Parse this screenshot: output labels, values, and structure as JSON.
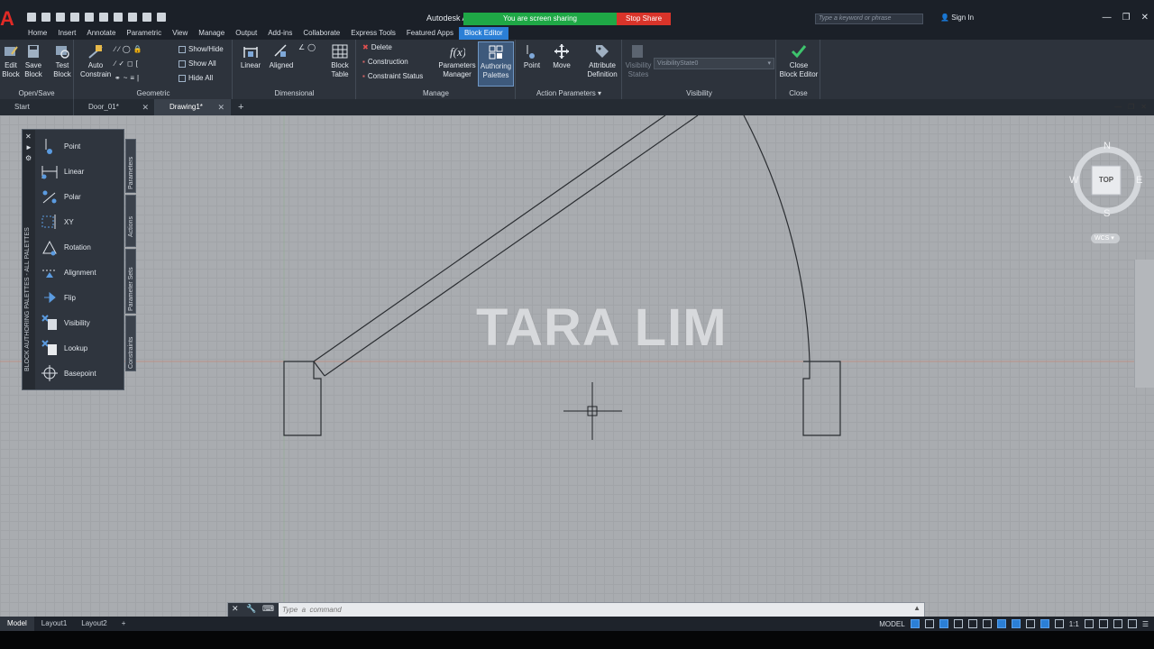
{
  "app": {
    "title": "Autodesk A",
    "logo": "A",
    "share_label": "You are screen sharing",
    "stop_share_label": "Stop Share",
    "search_placeholder": "Type a keyword or phrase",
    "signin_label": "Sign In"
  },
  "menu_tabs": [
    "Home",
    "Insert",
    "Annotate",
    "Parametric",
    "View",
    "Manage",
    "Output",
    "Add-ins",
    "Collaborate",
    "Express Tools",
    "Featured Apps",
    "Block Editor"
  ],
  "ribbon": {
    "open_save": {
      "title": "Open/Save",
      "edit_block": "Edit\nBlock",
      "save_block": "Save\nBlock",
      "test_block": "Test\nBlock"
    },
    "geometric": {
      "title": "Geometric",
      "auto_constrain": "Auto\nConstrain",
      "show_hide": "Show/Hide",
      "show_all": "Show All",
      "hide_all": "Hide All"
    },
    "dimensional": {
      "title": "Dimensional",
      "linear": "Linear",
      "aligned": "Aligned",
      "block_table": "Block\nTable"
    },
    "manage": {
      "title": "Manage",
      "delete": "Delete",
      "construction": "Construction",
      "constraint_status": "Constraint Status",
      "parameters_manager": "Parameters\nManager",
      "authoring_palettes": "Authoring\nPalettes"
    },
    "action_parameters": {
      "title": "Action Parameters",
      "point": "Point",
      "move": "Move",
      "attribute_definition": "Attribute\nDefinition"
    },
    "visibility": {
      "title": "Visibility",
      "visibility_states": "Visibility\nStates",
      "state_value": "VisibilityState0"
    },
    "close": {
      "title": "Close",
      "close_block_editor": "Close\nBlock Editor"
    }
  },
  "doc_tabs": [
    {
      "label": "Start"
    },
    {
      "label": "Door_01*"
    },
    {
      "label": "Drawing1*"
    }
  ],
  "palette": {
    "vertical_title": "BLOCK AUTHORING PALETTES - ALL PALETTES",
    "items": [
      "Point",
      "Linear",
      "Polar",
      "XY",
      "Rotation",
      "Alignment",
      "Flip",
      "Visibility",
      "Lookup",
      "Basepoint"
    ],
    "side_tabs": [
      "Parameters",
      "Actions",
      "Parameter Sets",
      "Constraints"
    ]
  },
  "watermark": "TARA LIM",
  "viewcube": {
    "n": "N",
    "s": "S",
    "e": "E",
    "w": "W",
    "face": "TOP",
    "ucs": "WCS"
  },
  "command": {
    "placeholder": "Type  a  command"
  },
  "layout_tabs": [
    "Model",
    "Layout1",
    "Layout2"
  ],
  "status": {
    "model": "MODEL",
    "scale": "1:1"
  }
}
